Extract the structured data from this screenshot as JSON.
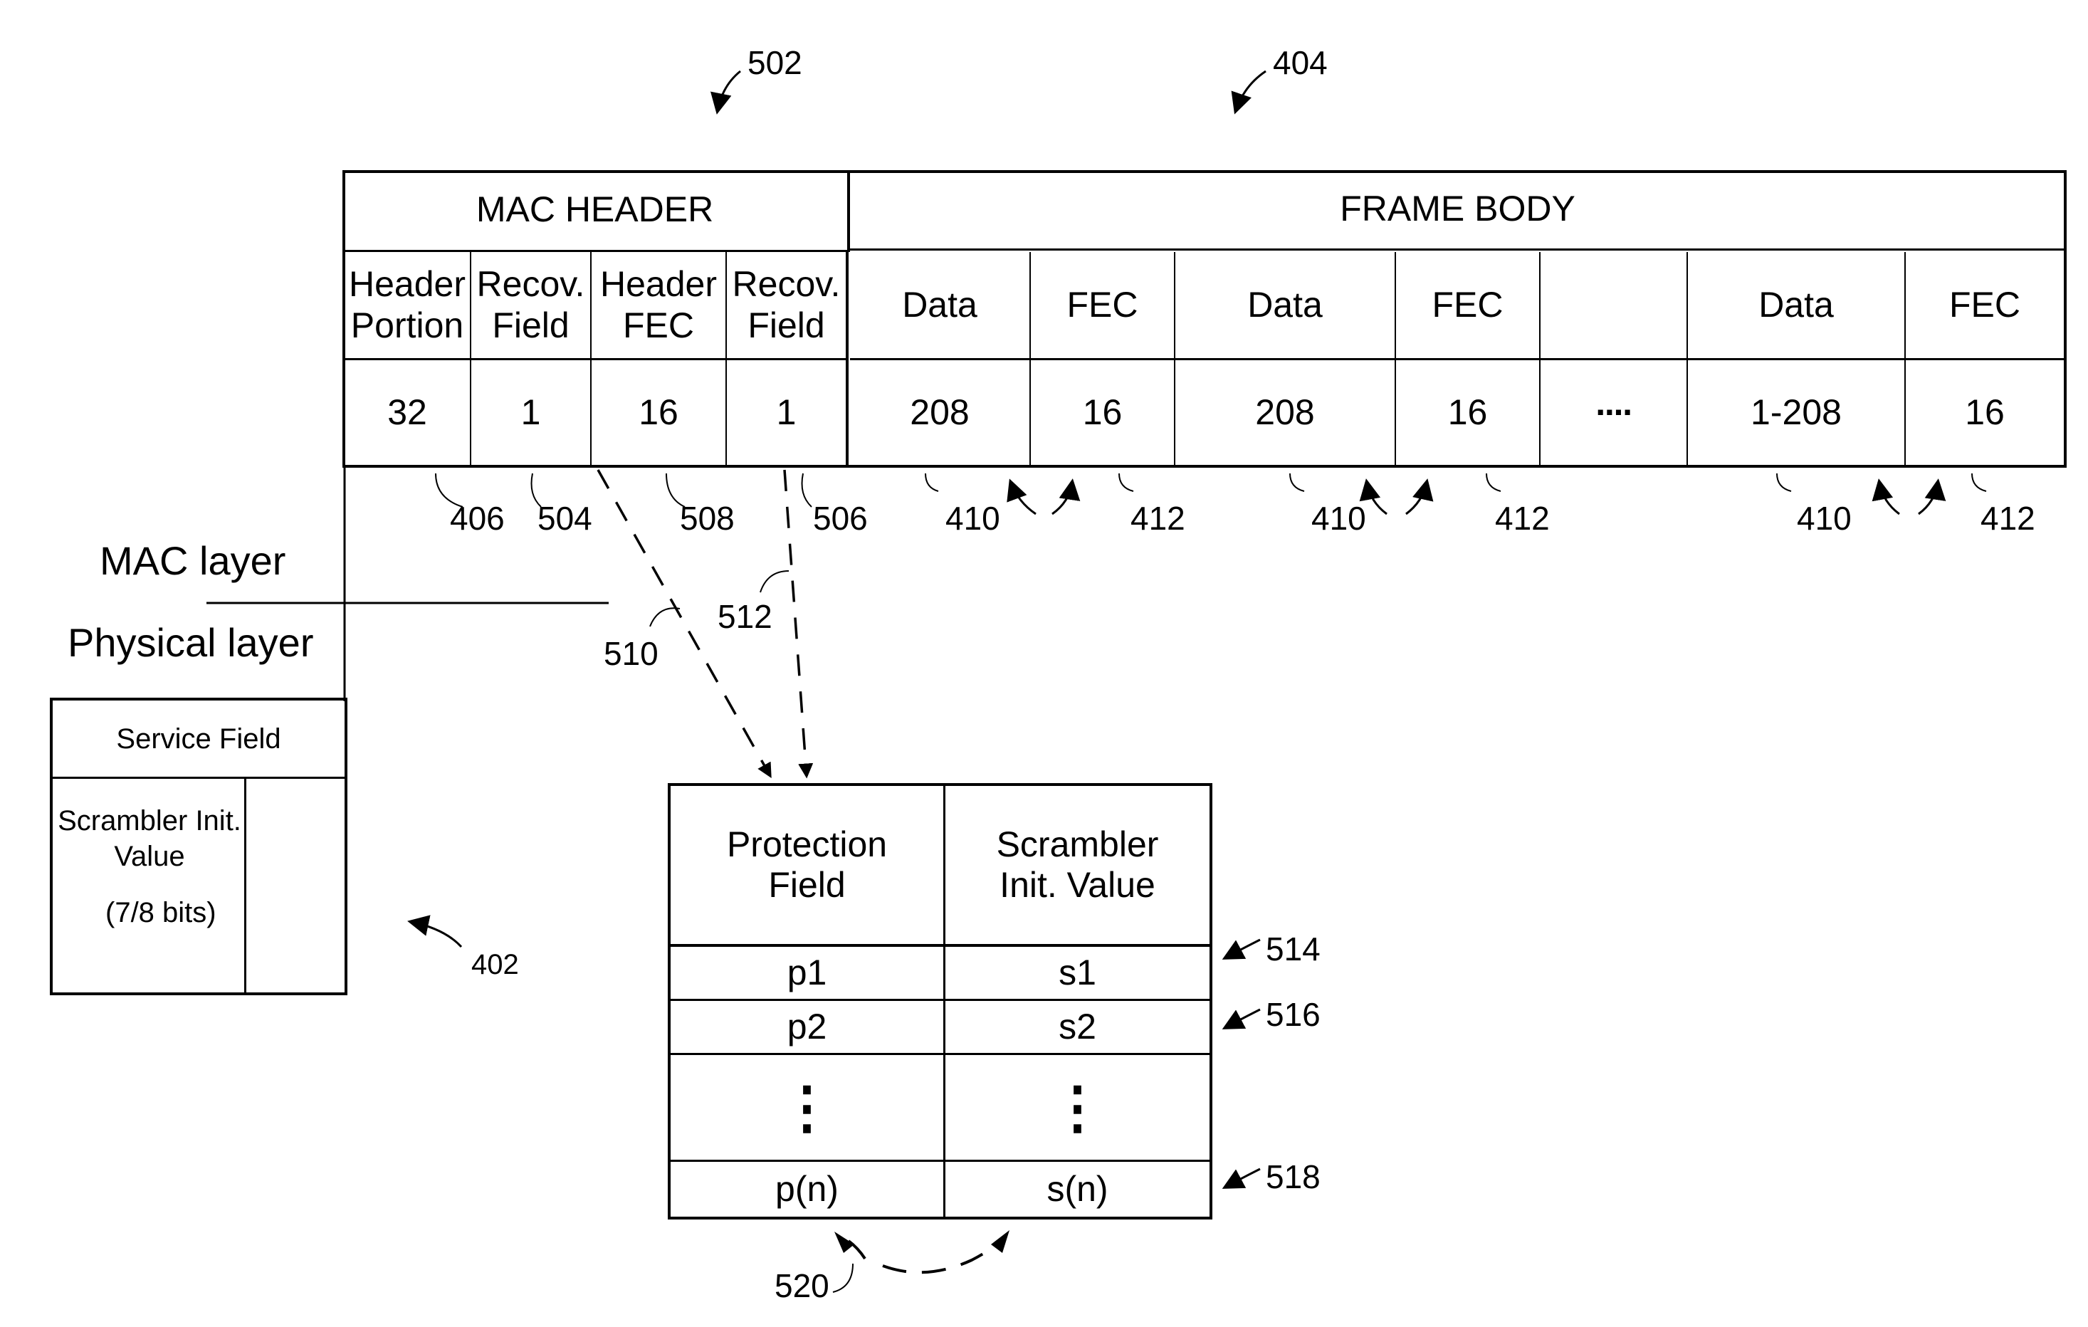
{
  "figure": {
    "refs": {
      "frame": "502",
      "frame_body": "404",
      "header_portion": "406",
      "recov_field_1": "504",
      "header_fec": "508",
      "recov_field_2": "506",
      "data_block": "410",
      "fec_block": "412",
      "arrow_recov_1": "510",
      "arrow_recov_2": "512",
      "service_field": "402",
      "row_1": "514",
      "row_2": "516",
      "row_n": "518",
      "mapping": "520"
    },
    "mac_header": {
      "title": "MAC HEADER",
      "fields": [
        {
          "label": "Header Portion",
          "bits": "32"
        },
        {
          "label": "Recov. Field",
          "bits": "1"
        },
        {
          "label": "Header FEC",
          "bits": "16"
        },
        {
          "label": "Recov. Field",
          "bits": "1"
        }
      ]
    },
    "frame_body": {
      "title": "FRAME BODY",
      "fields": [
        {
          "label": "Data",
          "bits": "208"
        },
        {
          "label": "FEC",
          "bits": "16"
        },
        {
          "label": "Data",
          "bits": "208"
        },
        {
          "label": "FEC",
          "bits": "16"
        },
        {
          "label": "",
          "bits": "····"
        },
        {
          "label": "Data",
          "bits": "1-208"
        },
        {
          "label": "FEC",
          "bits": "16"
        }
      ]
    },
    "layers": {
      "mac": "MAC layer",
      "physical": "Physical layer"
    },
    "service_field": {
      "title": "Service Field",
      "scrambler_label": "Scrambler Init. Value",
      "scrambler_bits": "(7/8 bits)"
    },
    "mapping_table": {
      "headers": [
        "Protection Field",
        "Scrambler Init. Value"
      ],
      "rows": [
        [
          "p1",
          "s1"
        ],
        [
          "p2",
          "s2"
        ],
        [
          "⋮",
          "⋮"
        ],
        [
          "p(n)",
          "s(n)"
        ]
      ]
    }
  }
}
